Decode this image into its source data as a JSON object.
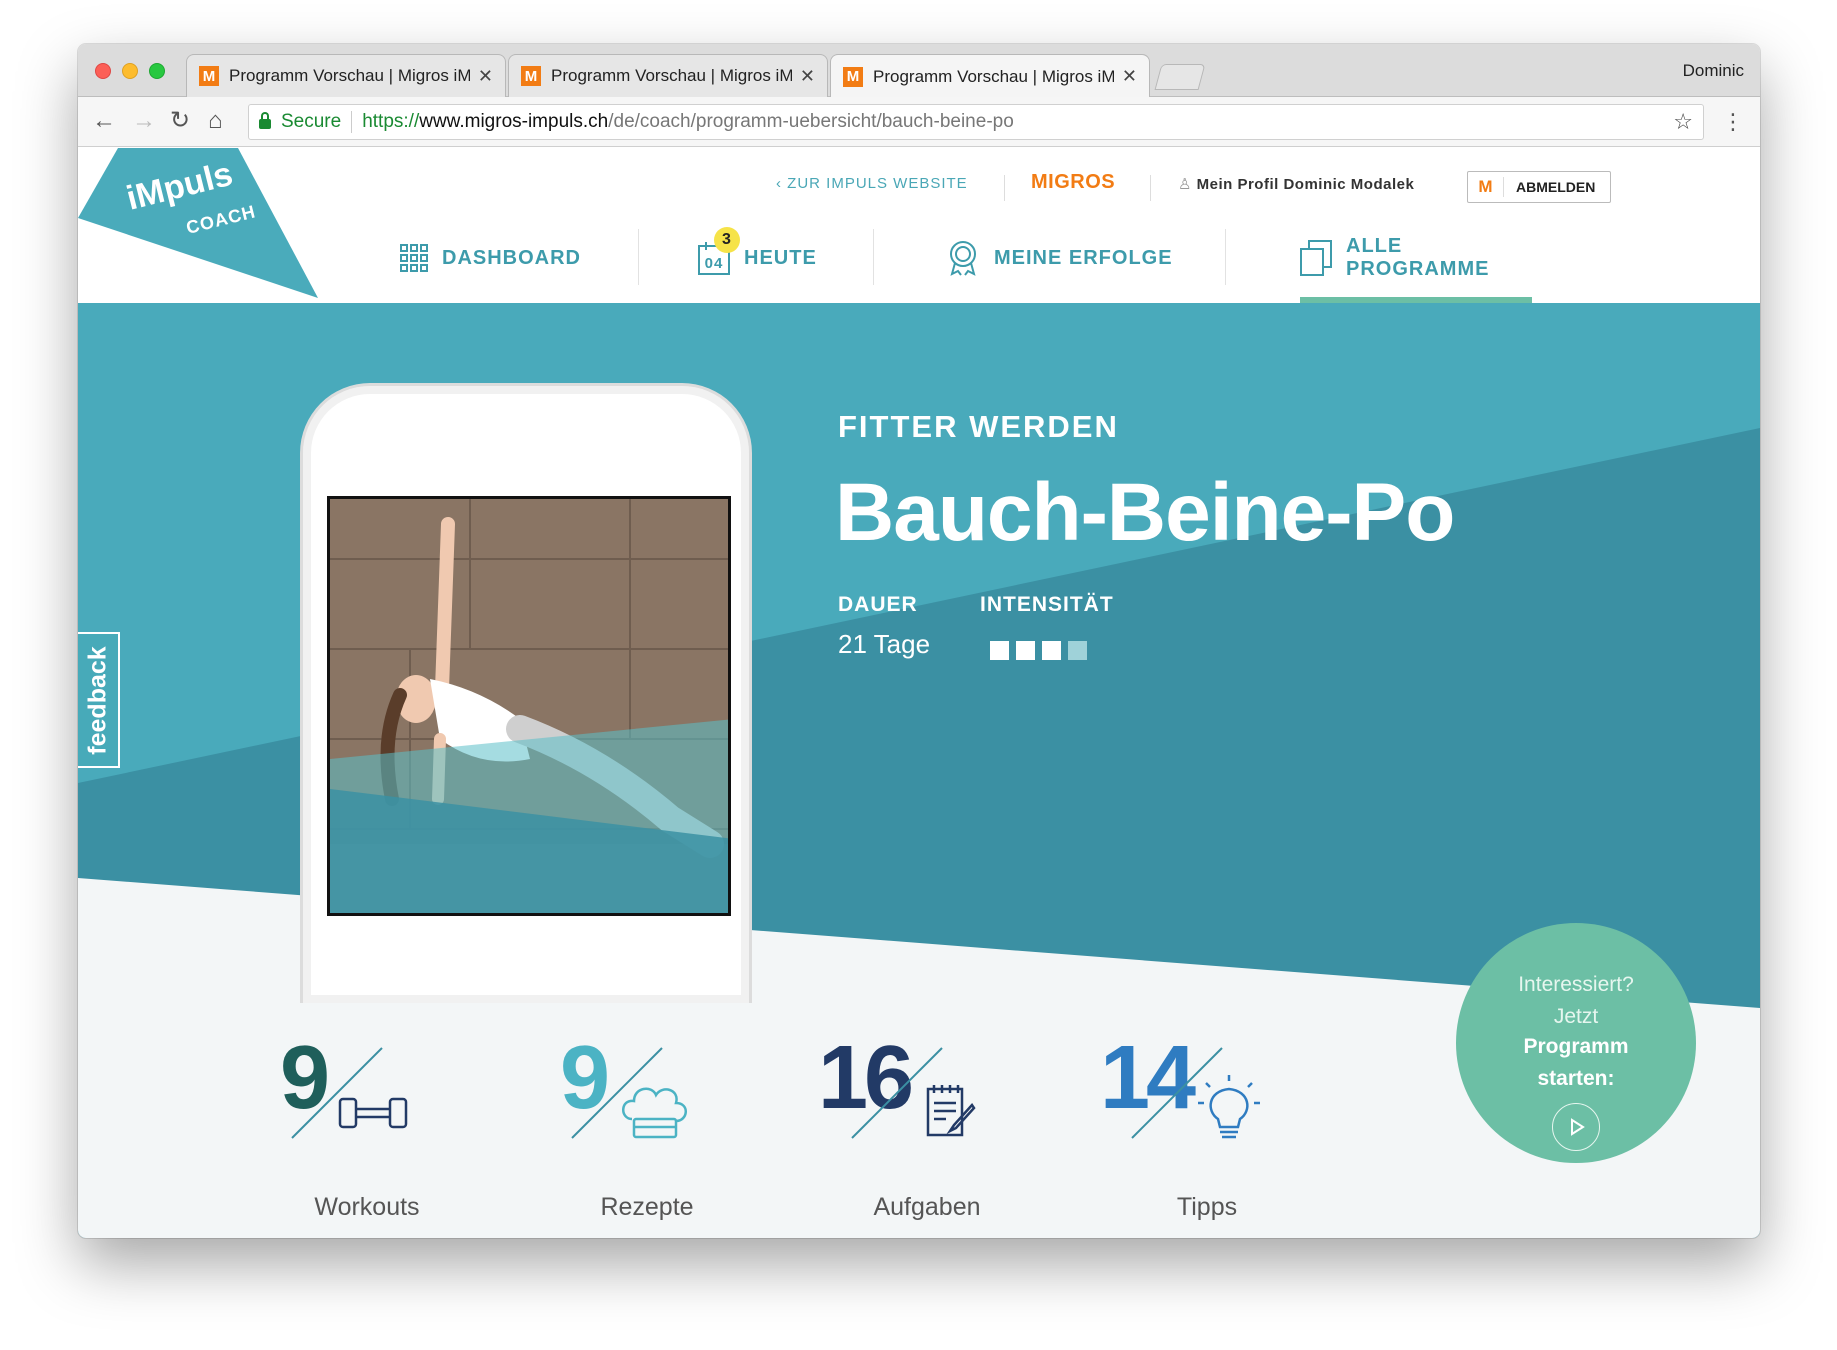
{
  "browser": {
    "tabs": [
      {
        "title": "Programm Vorschau | Migros iMpuls",
        "favicon": "M"
      },
      {
        "title": "Programm Vorschau | Migros iMpuls",
        "favicon": "M"
      },
      {
        "title": "Programm Vorschau | Migros iMpuls",
        "favicon": "M"
      }
    ],
    "profile": "Dominic",
    "secure_label": "Secure",
    "url_scheme": "https://",
    "url_host": "www.migros-impuls.ch",
    "url_path": "/de/coach/programm-uebersicht/bauch-beine-po"
  },
  "header": {
    "logo_top": "iMpuls",
    "logo_bottom": "COACH",
    "back_link": "ZUR IMPULS WEBSITE",
    "brand": "MIGROS",
    "profile_link": "Mein Profil Dominic Modalek",
    "logout_m": "M",
    "logout_label": "ABMELDEN",
    "nav": [
      {
        "label": "DASHBOARD",
        "icon": "grid-icon"
      },
      {
        "label": "HEUTE",
        "icon": "calendar-icon",
        "day": "04",
        "badge": "3"
      },
      {
        "label": "MEINE ERFOLGE",
        "icon": "award-icon"
      },
      {
        "label": "ALLE PROGRAMME",
        "icon": "copy-icon",
        "active": true
      }
    ]
  },
  "hero": {
    "kicker": "FITTER WERDEN",
    "title": "Bauch-Beine-Po",
    "duration_label": "DAUER",
    "duration_value": "21 Tage",
    "intensity_label": "INTENSITÄT",
    "intensity_level": 3,
    "intensity_max": 4,
    "feedback": "feedback"
  },
  "stats": [
    {
      "count": "9",
      "label": "Workouts",
      "icon": "dumbbell-icon",
      "color": "#1f5f5b"
    },
    {
      "count": "9",
      "label": "Rezepte",
      "icon": "chef-hat-icon",
      "color": "#4bb3c4"
    },
    {
      "count": "16",
      "label": "Aufgaben",
      "icon": "notepad-icon",
      "color": "#223a66"
    },
    {
      "count": "14",
      "label": "Tipps",
      "icon": "lightbulb-icon",
      "color": "#2f7cc1"
    }
  ],
  "cta": {
    "line1": "Interessiert?",
    "line2": "Jetzt",
    "line3": "Programm",
    "line4": "starten:"
  },
  "colors": {
    "teal_light": "#4aabbb",
    "teal_dark": "#3a8fa1",
    "mint": "#6cbfa5",
    "migros_orange": "#f27c14"
  }
}
